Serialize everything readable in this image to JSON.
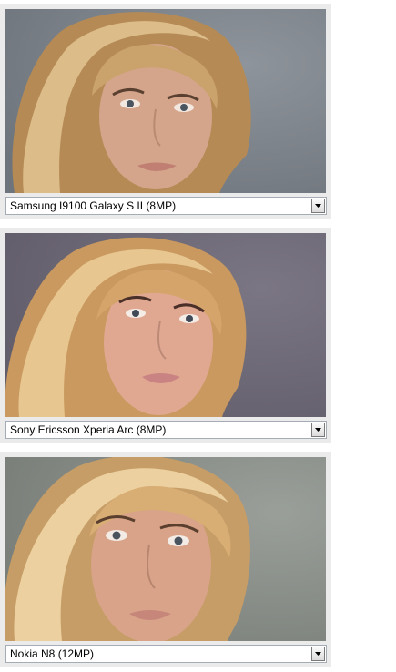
{
  "comparisons": [
    {
      "camera": "Samsung I9100 Galaxy S II (8MP)",
      "icon": "chevron-down-icon",
      "image": "portrait-woman-blonde-hair",
      "colors": {
        "backdrop": "#7f858c",
        "hair": "#c9a46c",
        "skin": "#d6a98a"
      }
    },
    {
      "camera": "Sony Ericsson Xperia Arc (8MP)",
      "icon": "chevron-down-icon",
      "image": "portrait-woman-blonde-hair",
      "colors": {
        "backdrop": "#6f6a78",
        "hair": "#d7ae77",
        "skin": "#dfa992"
      }
    },
    {
      "camera": "Nokia N8 (12MP)",
      "icon": "chevron-down-icon",
      "image": "portrait-woman-blonde-hair",
      "colors": {
        "backdrop": "#8e938e",
        "hair": "#d9b17a",
        "skin": "#d9a68a"
      }
    }
  ]
}
